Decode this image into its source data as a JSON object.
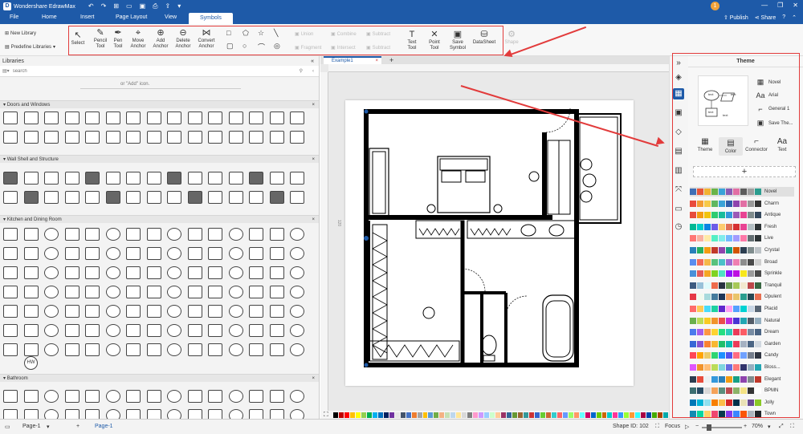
{
  "app": {
    "title": "Wondershare EdrawMax",
    "icon": "edrawmax-logo-icon",
    "user_initial": "1"
  },
  "quick_access": [
    "undo-icon",
    "redo-icon",
    "new-icon",
    "open-icon",
    "save-icon",
    "print-icon",
    "export-icon",
    "more-icon"
  ],
  "menu": {
    "items": [
      "File",
      "Home",
      "Insert",
      "Page Layout",
      "View",
      "Symbols"
    ],
    "active": "Symbols",
    "publish": "Publish",
    "share": "Share",
    "help": "?"
  },
  "ribbon": {
    "new_library": "New Library",
    "predefine_libraries": "Predefine Libraries",
    "tools": [
      {
        "label": "Select",
        "icon": "cursor-icon"
      },
      {
        "label": "Pencil Tool",
        "icon": "pencil-icon"
      },
      {
        "label": "Pen Tool",
        "icon": "pen-icon"
      },
      {
        "label": "Move Anchor",
        "icon": "move-anchor-icon"
      },
      {
        "label": "Add Anchor",
        "icon": "add-anchor-icon"
      },
      {
        "label": "Delete Anchor",
        "icon": "delete-anchor-icon"
      },
      {
        "label": "Convert Anchor",
        "icon": "convert-anchor-icon"
      }
    ],
    "ops": [
      "Union",
      "Combine",
      "Subtract",
      "Fragment",
      "Intersect",
      "Subtract"
    ],
    "right_tools": [
      {
        "label": "Text Tool",
        "icon": "text-tool-icon"
      },
      {
        "label": "Point Tool",
        "icon": "point-tool-icon"
      },
      {
        "label": "Save Symbol",
        "icon": "save-symbol-icon"
      },
      {
        "label": "DataSheet",
        "icon": "datasheet-icon"
      },
      {
        "label": "Shape",
        "icon": "shape-icon"
      }
    ]
  },
  "libraries": {
    "header": "Libraries",
    "search_placeholder": "search",
    "hint": "or \"Add\" icon.",
    "categories": [
      "Doors and Windows",
      "Wall Shell and Structure",
      "Kitchen and Dining Room",
      "Bathroom"
    ],
    "hw_label": "HW"
  },
  "canvas": {
    "tab": "Example1",
    "side_marker": "120"
  },
  "theme_panel": {
    "title": "Theme",
    "options": [
      {
        "label": "Novel",
        "icon": "theme-color-icon"
      },
      {
        "label": "Arial",
        "icon": "font-icon"
      },
      {
        "label": "General 1",
        "icon": "connector-icon"
      },
      {
        "label": "Save The...",
        "icon": "save-theme-icon"
      }
    ],
    "tabs": [
      {
        "label": "Theme",
        "icon": "theme-grid-icon"
      },
      {
        "label": "Color",
        "icon": "color-icon"
      },
      {
        "label": "Connector",
        "icon": "connector-style-icon"
      },
      {
        "label": "Text",
        "icon": "text-style-icon"
      }
    ],
    "selected_tab": "Color",
    "add": "+",
    "preview_text": "text",
    "themes": [
      {
        "name": "Novel",
        "colors": [
          "#3f6fb5",
          "#e6553a",
          "#f2b233",
          "#69b44a",
          "#3aa3d8",
          "#8a5cb5",
          "#e26fa4",
          "#5c5c5c",
          "#a0a0a0",
          "#2a9d8f"
        ]
      },
      {
        "name": "Charm",
        "colors": [
          "#e94b3c",
          "#f39c34",
          "#f7c948",
          "#5fb760",
          "#3aa3d8",
          "#2f5eaa",
          "#8e44ad",
          "#e26fa4",
          "#999",
          "#333"
        ]
      },
      {
        "name": "Antique",
        "colors": [
          "#e74c3c",
          "#f39c12",
          "#f1c40f",
          "#2ecc71",
          "#1abc9c",
          "#3498db",
          "#9b59b6",
          "#e84393",
          "#7f8c8d",
          "#34495e"
        ]
      },
      {
        "name": "Fresh",
        "colors": [
          "#00b894",
          "#00cec9",
          "#0984e3",
          "#6c5ce7",
          "#fdcb6e",
          "#e17055",
          "#d63031",
          "#e84393",
          "#b2bec3",
          "#2d3436"
        ]
      },
      {
        "name": "Live",
        "colors": [
          "#ff7675",
          "#fab1a0",
          "#ffeaa7",
          "#55efc4",
          "#81ecec",
          "#74b9ff",
          "#a29bfe",
          "#fd79a8",
          "#636e72",
          "#2d3436"
        ]
      },
      {
        "name": "Crystal",
        "colors": [
          "#2980b9",
          "#27ae60",
          "#f39c12",
          "#c0392b",
          "#8e44ad",
          "#16a085",
          "#d35400",
          "#2c3e50",
          "#7f8c8d",
          "#bdc3c7"
        ]
      },
      {
        "name": "Broad",
        "colors": [
          "#5b8def",
          "#f26b5b",
          "#f5b84a",
          "#58c27d",
          "#4bc0c8",
          "#9d6bd4",
          "#ef7fb1",
          "#8d8d8d",
          "#4a4a4a",
          "#cfcfcf"
        ]
      },
      {
        "name": "Sprinkle",
        "colors": [
          "#4a90d9",
          "#e25c5c",
          "#f5a623",
          "#7ed321",
          "#50e3c2",
          "#9013fe",
          "#bd10e0",
          "#f8e71c",
          "#9b9b9b",
          "#4a4a4a"
        ]
      },
      {
        "name": "Tranquil",
        "colors": [
          "#3d5a80",
          "#98c1d9",
          "#e0fbfc",
          "#ee6c4d",
          "#293241",
          "#6a994e",
          "#a7c957",
          "#f2e8cf",
          "#bc4749",
          "#386641"
        ]
      },
      {
        "name": "Opulent",
        "colors": [
          "#e63946",
          "#f1faee",
          "#a8dadc",
          "#457b9d",
          "#1d3557",
          "#f4a261",
          "#e9c46a",
          "#2a9d8f",
          "#264653",
          "#e76f51"
        ]
      },
      {
        "name": "Placid",
        "colors": [
          "#ff6b6b",
          "#feca57",
          "#48dbfb",
          "#1dd1a1",
          "#5f27cd",
          "#ff9ff3",
          "#54a0ff",
          "#00d2d3",
          "#c8d6e5",
          "#576574"
        ]
      },
      {
        "name": "Natural",
        "colors": [
          "#6ab04c",
          "#badc58",
          "#f9ca24",
          "#f0932b",
          "#eb4d4b",
          "#be2edd",
          "#4834d4",
          "#22a6b3",
          "#535c68",
          "#95afc0"
        ]
      },
      {
        "name": "Dream",
        "colors": [
          "#4b7bec",
          "#a55eea",
          "#fd9644",
          "#fed330",
          "#26de81",
          "#2bcbba",
          "#eb3b5a",
          "#fc5c65",
          "#778ca3",
          "#4b6584"
        ]
      },
      {
        "name": "Garden",
        "colors": [
          "#3867d6",
          "#8854d0",
          "#fa8231",
          "#f7b731",
          "#20bf6b",
          "#0fb9b1",
          "#eb3b5a",
          "#a5b1c2",
          "#4b6584",
          "#d1d8e0"
        ]
      },
      {
        "name": "Candy",
        "colors": [
          "#ff4757",
          "#ffa502",
          "#eccc68",
          "#2ed573",
          "#1e90ff",
          "#5352ed",
          "#ff6b81",
          "#70a1ff",
          "#747d8c",
          "#2f3542"
        ]
      },
      {
        "name": "Bloss...",
        "colors": [
          "#e056fd",
          "#f0932b",
          "#ffbe76",
          "#badc58",
          "#7ed6df",
          "#686de0",
          "#ff7979",
          "#30336b",
          "#95afc0",
          "#22a6b3"
        ]
      },
      {
        "name": "Elegant",
        "colors": [
          "#2c3e50",
          "#e74c3c",
          "#ecf0f1",
          "#3498db",
          "#2980b9",
          "#f39c12",
          "#16a085",
          "#8e44ad",
          "#7f8c8d",
          "#c0392b"
        ]
      },
      {
        "name": "BPMN",
        "colors": [
          "#3c6e71",
          "#284b63",
          "#d9d9d9",
          "#f4a259",
          "#5b8e7d",
          "#bc4b51",
          "#8cb369",
          "#f4e285",
          "#353535",
          "#ffffff"
        ]
      },
      {
        "name": "Jolly",
        "colors": [
          "#0077b6",
          "#00b4d8",
          "#90e0ef",
          "#f77f00",
          "#fcbf49",
          "#d62828",
          "#003049",
          "#eae2b7",
          "#6a4c93",
          "#8ac926"
        ]
      },
      {
        "name": "Town",
        "colors": [
          "#118ab2",
          "#06d6a0",
          "#ffd166",
          "#ef476f",
          "#073b4c",
          "#8338ec",
          "#3a86ff",
          "#fb5607",
          "#adb5bd",
          "#212529"
        ]
      }
    ]
  },
  "status": {
    "page_selector": "Page-1",
    "page_tab": "Page-1",
    "shape_id": "Shape ID: 102",
    "focus": "Focus",
    "zoom": "70%"
  },
  "palette": [
    "#000000",
    "#c00000",
    "#ff0000",
    "#ffc000",
    "#ffff00",
    "#92d050",
    "#00b050",
    "#00b0f0",
    "#0070c0",
    "#002060",
    "#7030a0",
    "#e7e6e6",
    "#44546a",
    "#4472c4",
    "#ed7d31",
    "#a5a5a5",
    "#ffc000",
    "#5b9bd5",
    "#70ad47",
    "#f4b183",
    "#c5e0b4",
    "#bdd7ee",
    "#ffe699",
    "#d9d9d9",
    "#808080",
    "#ff99cc",
    "#cc99ff",
    "#99ccff",
    "#ccffcc",
    "#ffcc99",
    "#993366",
    "#336699",
    "#669933",
    "#996633",
    "#339999",
    "#cc3333",
    "#3366cc",
    "#66cc33",
    "#cc6633",
    "#33cccc",
    "#ff6666",
    "#6699ff",
    "#99ff66",
    "#ff9966",
    "#66ffff",
    "#cc0066",
    "#0066cc",
    "#66cc00",
    "#cc6600",
    "#00cccc",
    "#ff3399",
    "#3399ff",
    "#99ff33",
    "#ff9933",
    "#33ffff",
    "#aa0044",
    "#0044aa",
    "#44aa00",
    "#aa4400",
    "#00aaaa"
  ]
}
